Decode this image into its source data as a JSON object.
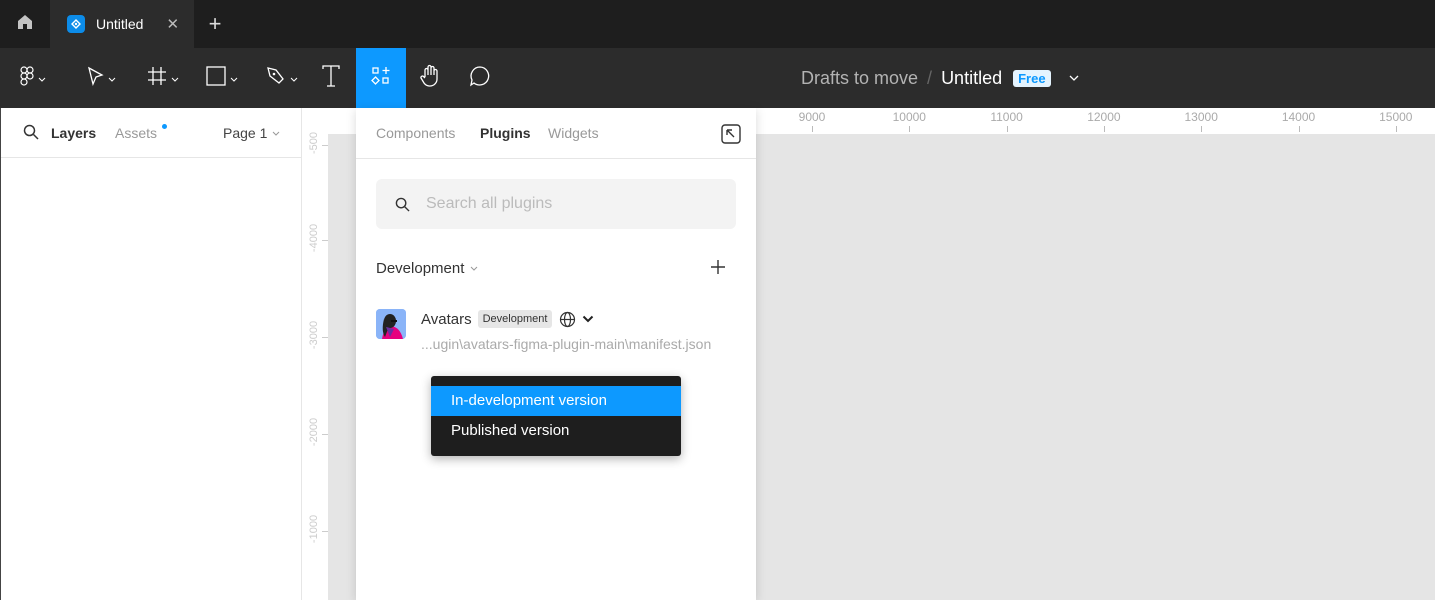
{
  "tabbar": {
    "home_icon": "home-icon",
    "file_tab": {
      "title": "Untitled",
      "close_icon": "close-icon"
    },
    "new_tab_label": "+"
  },
  "toolbar": {
    "tools": [
      {
        "name": "main-menu",
        "icon": "figma-logo-icon",
        "has_dropdown": true
      },
      {
        "name": "move",
        "icon": "move-cursor-icon",
        "has_dropdown": true
      },
      {
        "name": "frame",
        "icon": "frame-icon",
        "has_dropdown": true
      },
      {
        "name": "shape",
        "icon": "rectangle-icon",
        "has_dropdown": true
      },
      {
        "name": "pen",
        "icon": "pen-icon",
        "has_dropdown": true
      },
      {
        "name": "text",
        "icon": "text-icon",
        "has_dropdown": false
      },
      {
        "name": "resources",
        "icon": "resources-icon",
        "active": true
      },
      {
        "name": "hand",
        "icon": "hand-icon",
        "has_dropdown": false
      },
      {
        "name": "comment",
        "icon": "comment-icon",
        "has_dropdown": false
      }
    ],
    "breadcrumb": {
      "project": "Drafts to move",
      "separator": "/",
      "file": "Untitled",
      "plan_badge": "Free"
    }
  },
  "left_panel": {
    "tabs": [
      "Layers",
      "Assets"
    ],
    "active_tab": "Layers",
    "assets_has_notification": true,
    "page_selector": "Page 1"
  },
  "rulers": {
    "horizontal": [
      "9000",
      "10000",
      "11000",
      "12000",
      "13000",
      "14000",
      "15000"
    ],
    "vertical": [
      "-500",
      "-4000",
      "-3000",
      "-2000",
      "-1000"
    ]
  },
  "resources_panel": {
    "tabs": [
      "Components",
      "Plugins",
      "Widgets"
    ],
    "active_tab": "Plugins",
    "search_placeholder": "Search all plugins",
    "search_value": "",
    "section_label": "Development",
    "add_label": "+",
    "plugin": {
      "name": "Avatars",
      "badge": "Development",
      "path": "...ugin\\avatars-figma-plugin-main\\manifest.json"
    }
  },
  "version_dropdown": {
    "items": [
      "In-development version",
      "Published version"
    ],
    "selected": "In-development version"
  },
  "colors": {
    "accent": "#0d99ff",
    "toolbar_bg": "#2c2c2c",
    "tabbar_bg": "#1e1e1e",
    "canvas_bg": "#e5e5e5"
  }
}
